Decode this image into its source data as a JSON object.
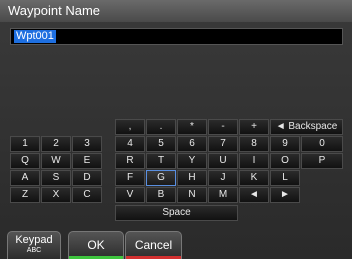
{
  "title": "Waypoint Name",
  "name_value": "Wpt001",
  "keyboard": {
    "symbols_row": [
      ",",
      ".",
      "*",
      "-",
      "+"
    ],
    "backspace_label": "◄ Backspace",
    "number_row": [
      "1",
      "2",
      "3",
      "4",
      "5",
      "6",
      "7",
      "8",
      "9",
      "0"
    ],
    "row_q": [
      "Q",
      "W",
      "E",
      "R",
      "T",
      "Y",
      "U",
      "I",
      "O",
      "P"
    ],
    "row_a": [
      "A",
      "S",
      "D",
      "F",
      "G",
      "H",
      "J",
      "K",
      "L"
    ],
    "row_z": [
      "Z",
      "X",
      "C",
      "V",
      "B",
      "N",
      "M"
    ],
    "left_arrow": "◄",
    "right_arrow": "►",
    "space_label": "Space",
    "selected_key": "G"
  },
  "softkeys": {
    "keypad_label": "Keypad",
    "keypad_sub": "ABC",
    "ok_label": "OK",
    "cancel_label": "Cancel"
  },
  "colors": {
    "selection": "#1e6fe0",
    "ok_bar": "#3ec43e",
    "cancel_bar": "#d23030"
  }
}
